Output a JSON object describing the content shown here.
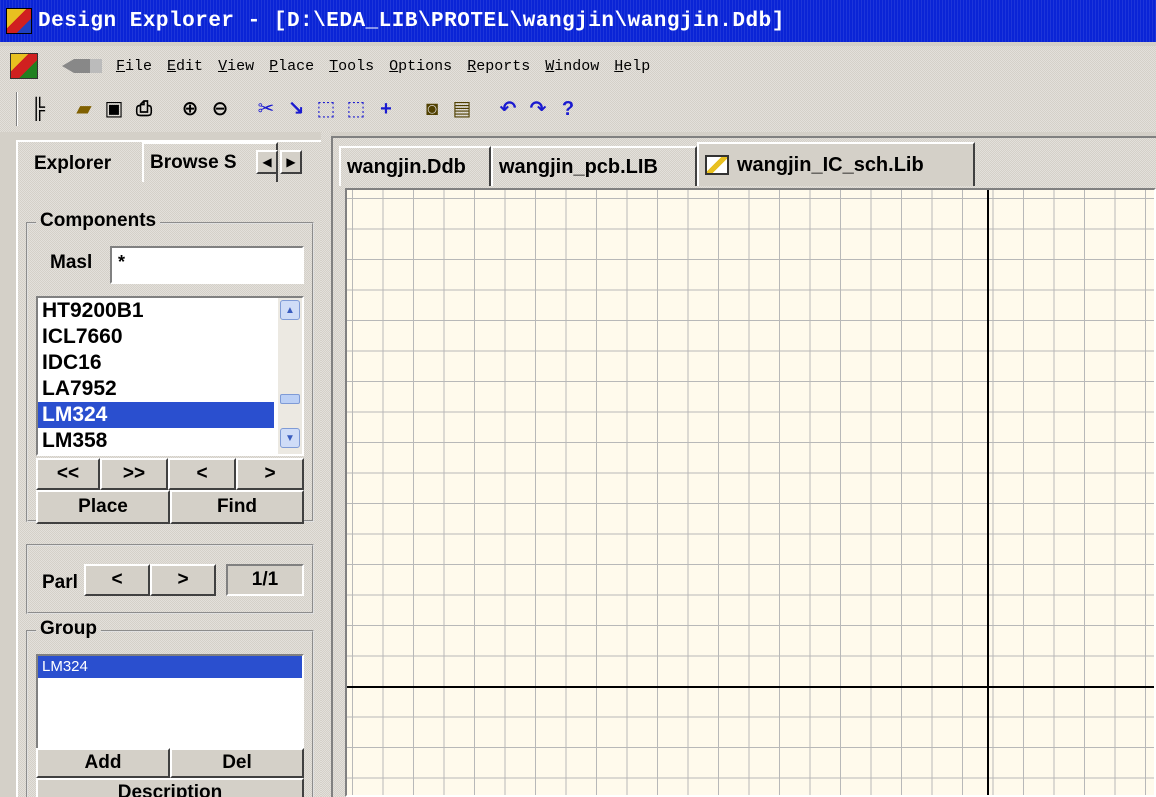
{
  "window": {
    "title": "Design Explorer - [D:\\EDA_LIB\\PROTEL\\wangjin\\wangjin.Ddb]"
  },
  "menu": [
    "File",
    "Edit",
    "View",
    "Place",
    "Tools",
    "Options",
    "Reports",
    "Window",
    "Help"
  ],
  "toolbar": {
    "icons": [
      "project-tree-icon",
      "open-folder-icon",
      "save-icon",
      "print-icon",
      "zoom-in-icon",
      "zoom-out-icon",
      "cut-wire-icon",
      "line-icon",
      "select-area-icon",
      "deselect-icon",
      "crosshair-icon",
      "component-icon",
      "part-icon",
      "undo-icon",
      "redo-icon",
      "help-icon"
    ]
  },
  "left_panel": {
    "tabs": [
      "Explorer",
      "Browse S"
    ],
    "components_label": "Components",
    "mask_label": "Masl",
    "mask_value": "*",
    "components": [
      "HT9200B1",
      "ICL7660",
      "IDC16",
      "LA7952",
      "LM324",
      "LM358"
    ],
    "selected_component": "LM324",
    "nav_buttons": [
      "<<",
      ">>",
      "<",
      ">"
    ],
    "place_button": "Place",
    "find_button": "Find",
    "part_label": "Parl",
    "part_prev": "<",
    "part_next": ">",
    "part_value": "1/1",
    "group_label": "Group",
    "group_items": [
      "LM324"
    ],
    "add_button": "Add",
    "del_button": "Del",
    "description_label": "Description"
  },
  "documents": {
    "tabs": [
      "wangjin.Ddb",
      "wangjin_pcb.LIB",
      "wangjin_IC_sch.Lib"
    ],
    "active_tab": "wangjin_IC_sch.Lib"
  }
}
